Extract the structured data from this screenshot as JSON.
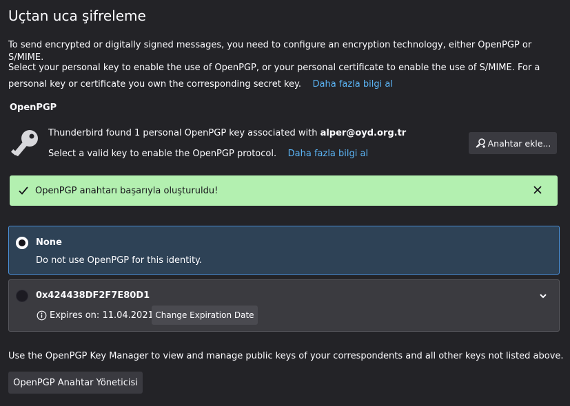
{
  "page": {
    "title": "Uçtan uca şifreleme",
    "intro_1": "To send encrypted or digitally signed messages, you need to configure an encryption technology, either OpenPGP or S/MIME.",
    "intro_2": "Select your personal key to enable the use of OpenPGP, or your personal certificate to enable the use of S/MIME. For a personal key or certificate you own the corresponding secret key.",
    "intro_link": "Daha fazla bilgi al"
  },
  "openpgp": {
    "heading": "OpenPGP",
    "found_prefix": "Thunderbird found 1 personal OpenPGP key associated with ",
    "found_email": "alper@oyd.org.tr",
    "select_text": "Select a valid key to enable the OpenPGP protocol.",
    "select_link": "Daha fazla bilgi al",
    "add_key_button": "Anahtar ekle...",
    "success_message": "OpenPGP anahtarı başarıyla oluşturuldu!",
    "options": [
      {
        "title": "None",
        "description": "Do not use OpenPGP for this identity.",
        "selected": true
      },
      {
        "title": "0x424438DF2F7E80D1",
        "expires": "Expires on: 11.04.2021",
        "change_button": "Change Expiration Date",
        "selected": false
      }
    ]
  },
  "footer": {
    "text": "Use the OpenPGP Key Manager to view and manage public keys of your correspondents and all other keys not listed above.",
    "manager_button": "OpenPGP Anahtar Yöneticisi"
  },
  "colors": {
    "background": "#232327",
    "link": "#5bb4f5",
    "success_bg": "#b3f0b0",
    "selected_bg": "#2e4256",
    "selected_border": "#4a90d9"
  },
  "icons": [
    "key-icon",
    "add-key-icon",
    "checkmark-icon",
    "close-icon",
    "radio-icon",
    "chevron-down-icon",
    "info-icon"
  ]
}
